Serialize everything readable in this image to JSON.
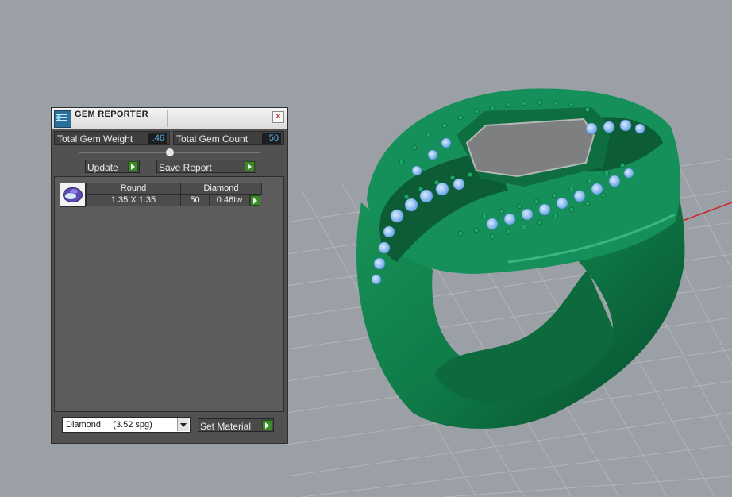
{
  "panel": {
    "title": "GEM REPORTER",
    "close_icon": "close-icon",
    "app_icon": "gem-reporter-icon",
    "total_gem_weight_label": "Total Gem Weight",
    "total_gem_weight_value": ".46",
    "total_gem_count_label": "Total Gem Count",
    "total_gem_count_value": "50",
    "update_label": "Update",
    "save_report_label": "Save Report",
    "gem_rows": [
      {
        "shape": "Round",
        "material": "Diamond",
        "size": "1.35 X 1.35",
        "count": "50",
        "weight": "0.46tw"
      }
    ],
    "material_select_value": "Diamond     (3.52 spg)",
    "set_material_label": "Set Material"
  },
  "colors": {
    "ring_green": "#127a4a",
    "gem_blue": "#8fc0ee",
    "panel_bg": "#515151",
    "value_text": "#5db2e8",
    "go_button": "#3c8a28"
  }
}
